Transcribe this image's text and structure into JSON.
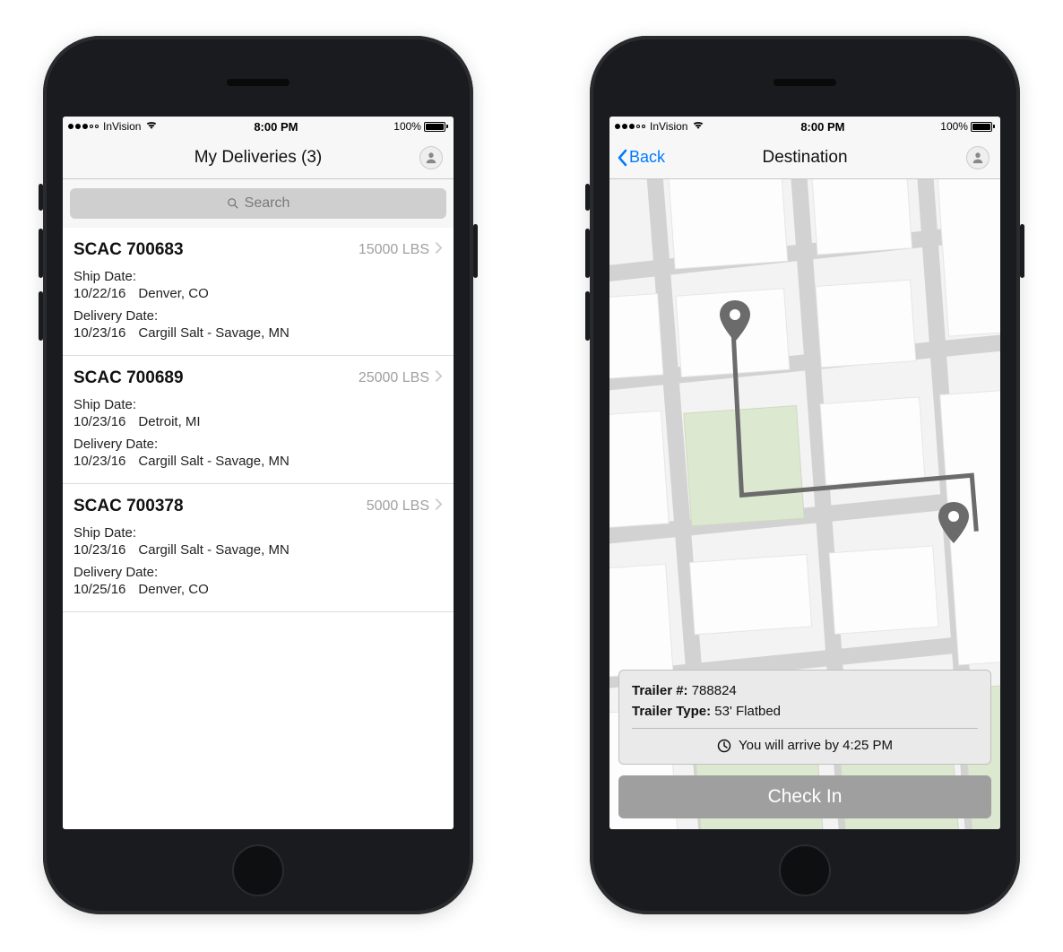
{
  "status_bar": {
    "carrier": "InVision",
    "time": "8:00 PM",
    "battery": "100%"
  },
  "screen_a": {
    "title": "My Deliveries (3)",
    "search_placeholder": "Search",
    "deliveries": [
      {
        "id": "SCAC 700683",
        "weight": "15000 LBS",
        "ship_label": "Ship Date:",
        "ship_date": "10/22/16",
        "ship_location": "Denver, CO",
        "delivery_label": "Delivery Date:",
        "delivery_date": "10/23/16",
        "delivery_location": "Cargill Salt - Savage, MN"
      },
      {
        "id": "SCAC 700689",
        "weight": "25000 LBS",
        "ship_label": "Ship Date:",
        "ship_date": "10/23/16",
        "ship_location": "Detroit, MI",
        "delivery_label": "Delivery Date:",
        "delivery_date": "10/23/16",
        "delivery_location": "Cargill Salt - Savage, MN"
      },
      {
        "id": "SCAC 700378",
        "weight": "5000 LBS",
        "ship_label": "Ship Date:",
        "ship_date": "10/23/16",
        "ship_location": "Cargill Salt - Savage, MN",
        "delivery_label": "Delivery Date:",
        "delivery_date": "10/25/16",
        "delivery_location": "Denver, CO"
      }
    ]
  },
  "screen_b": {
    "back_label": "Back",
    "title": "Destination",
    "trailer_number_label": "Trailer #:",
    "trailer_number": "788824",
    "trailer_type_label": "Trailer Type:",
    "trailer_type": "53' Flatbed",
    "eta_text": "You will arrive by 4:25 PM",
    "checkin_label": "Check In"
  }
}
